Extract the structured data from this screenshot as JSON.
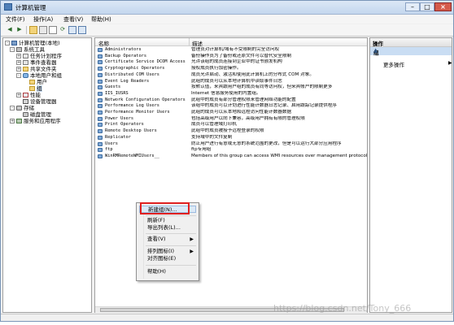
{
  "window": {
    "title": "计算机管理"
  },
  "menu": [
    "文件(F)",
    "操作(A)",
    "查看(V)",
    "帮助(H)"
  ],
  "tree": [
    {
      "label": "计算机管理(本地)",
      "level": 0,
      "expander": "-",
      "icon": "computer-icon"
    },
    {
      "label": "系统工具",
      "level": 1,
      "expander": "-",
      "icon": "tools-icon"
    },
    {
      "label": "任务计划程序",
      "level": 2,
      "expander": "+",
      "icon": "clock-icon"
    },
    {
      "label": "事件查看器",
      "level": 2,
      "expander": "+",
      "icon": "event-log-icon"
    },
    {
      "label": "共享文件夹",
      "level": 2,
      "expander": "+",
      "icon": "folder-icon"
    },
    {
      "label": "本地用户和组",
      "level": 2,
      "expander": "-",
      "icon": "users-icon"
    },
    {
      "label": "用户",
      "level": 3,
      "expander": "",
      "icon": "folder-icon"
    },
    {
      "label": "组",
      "level": 3,
      "expander": "",
      "icon": "folder-icon",
      "selected": true
    },
    {
      "label": "性能",
      "level": 2,
      "expander": "+",
      "icon": "performance-icon"
    },
    {
      "label": "设备管理器",
      "level": 2,
      "expander": "",
      "icon": "device-icon"
    },
    {
      "label": "存储",
      "level": 1,
      "expander": "-",
      "icon": "storage-icon"
    },
    {
      "label": "磁盘管理",
      "level": 2,
      "expander": "",
      "icon": "disk-icon"
    },
    {
      "label": "服务和应用程序",
      "level": 1,
      "expander": "+",
      "icon": "services-icon"
    }
  ],
  "list": {
    "columns": [
      "名称",
      "描述"
    ],
    "rows": [
      {
        "name": "Administrators",
        "desc": "管理员对计算机/域有不受限制的完全访问权"
      },
      {
        "name": "Backup Operators",
        "desc": "备份操作员为了备份或还原文件可以替代安全限制"
      },
      {
        "name": "Certificate Service DCOM Access",
        "desc": "允许该组的成员连接到企业中的证书颁发机构"
      },
      {
        "name": "Cryptographic Operators",
        "desc": "授权成员执行加密操作。"
      },
      {
        "name": "Distributed COM Users",
        "desc": "成员允许启动、激活和使用此计算机上的分布式 COM 对象。"
      },
      {
        "name": "Event Log Readers",
        "desc": "此组的成员可以从本地计算机中读取事件日志"
      },
      {
        "name": "Guests",
        "desc": "按默认值，来宾跟用户组的成员有同等访问权，但来宾帐户的限制更多"
      },
      {
        "name": "IIS_IUSRS",
        "desc": "Internet 信息服务使用的内置组。"
      },
      {
        "name": "Network Configuration Operators",
        "desc": "此组中的成员有部分管理权限来管理网络功能的配置"
      },
      {
        "name": "Performance Log Users",
        "desc": "该组中的成员可以计划进行性能计数器日志记录、启用跟踪记录提供程序"
      },
      {
        "name": "Performance Monitor Users",
        "desc": "此组的成员可以从本地和远程访问性能计数器数据"
      },
      {
        "name": "Power Users",
        "desc": "包括高级用户以向下兼容，高级用户拥有有限的管理权限"
      },
      {
        "name": "Print Operators",
        "desc": "成员可以管理域打印机"
      },
      {
        "name": "Remote Desktop Users",
        "desc": "此组中的成员被授予远程登录的权限"
      },
      {
        "name": "Replicator",
        "desc": "支持域中的文件复制"
      },
      {
        "name": "Users",
        "desc": "防止用户进行有意或无意的系统范围的更改，但是可以运行大部分应用程序"
      },
      {
        "name": "ftp",
        "desc": "ftp专用组"
      },
      {
        "name": "WinRMRemoteWMIUsers__",
        "desc": "Members of this group can access WMI resources over management protocols"
      }
    ]
  },
  "context_menu": [
    {
      "label": "新建组(N)...",
      "highlighted": true
    },
    {
      "separator": true
    },
    {
      "label": "刷新(F)"
    },
    {
      "label": "导出列表(L)..."
    },
    {
      "separator": true
    },
    {
      "label": "查看(V)",
      "submenu": true
    },
    {
      "separator": true
    },
    {
      "label": "排列图标(I)",
      "submenu": true
    },
    {
      "label": "对齐图标(E)"
    },
    {
      "separator": true
    },
    {
      "label": "帮助(H)"
    }
  ],
  "actions": {
    "header": "操作",
    "section": "组",
    "more": "更多操作"
  },
  "watermark": "https://blog.csdn.net/Tony_666"
}
